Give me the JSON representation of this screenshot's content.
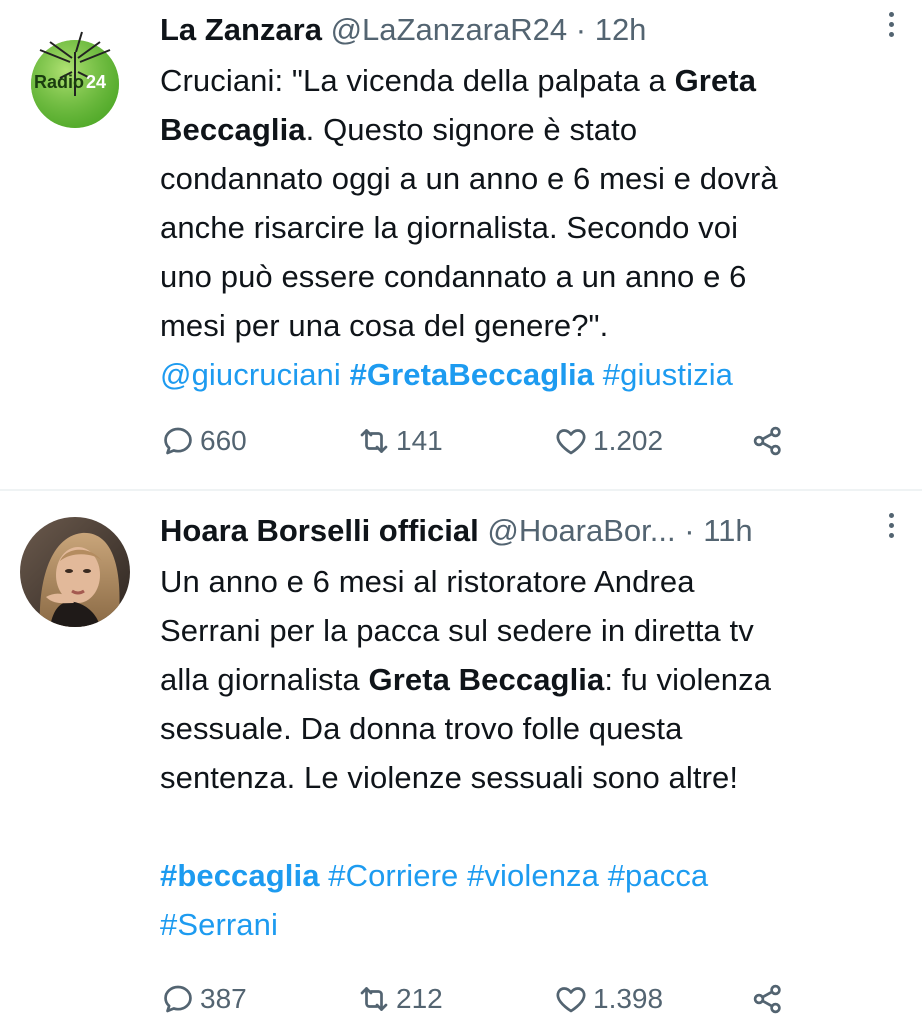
{
  "tweets": [
    {
      "name": "La Zanzara",
      "handle": "@LaZanzaraR24",
      "separator": "·",
      "time": "12h",
      "avatar_text": "Radio",
      "avatar_number": "24",
      "body": {
        "l1_a": "Cruciani: \"La vicenda della palpata a ",
        "l1_b": "Greta",
        "l2_a": "Beccaglia",
        "l2_b": ". Questo signore è stato",
        "l3": "condannato oggi a un anno e 6 mesi e dovrà",
        "l4": "anche risarcire la giornalista. Secondo voi",
        "l5": "uno può essere condannato a un anno e 6",
        "l6": "mesi per una cosa del genere?\".",
        "mention": "@giucruciani",
        "tag1": "#GretaBeccaglia",
        "tag2": "#giustizia"
      },
      "replies": "660",
      "retweets": "141",
      "likes": "1.202"
    },
    {
      "name": "Hoara Borselli official",
      "handle": "@HoaraBor...",
      "separator": "·",
      "time": "11h",
      "body": {
        "l1": "Un anno e 6 mesi al ristoratore Andrea",
        "l2": "Serrani per la pacca sul sedere in diretta tv",
        "l3_a": "alla giornalista ",
        "l3_b": "Greta Beccaglia",
        "l3_c": ": fu violenza",
        "l4": "sessuale. Da donna trovo folle questa",
        "l5": "sentenza. Le violenze sessuali sono altre!",
        "tag1": "#beccaglia",
        "tag2": "#Corriere",
        "tag3": "#violenza",
        "tag4": "#pacca",
        "tag5": "#Serrani"
      },
      "replies": "387",
      "retweets": "212",
      "likes": "1.398"
    }
  ],
  "colors": {
    "link": "#1d9bf0",
    "muted": "#536471",
    "text": "#0f1419",
    "radio_green": "#5cb82e"
  },
  "icons": [
    "reply-icon",
    "retweet-icon",
    "like-icon",
    "share-icon",
    "more-icon"
  ]
}
